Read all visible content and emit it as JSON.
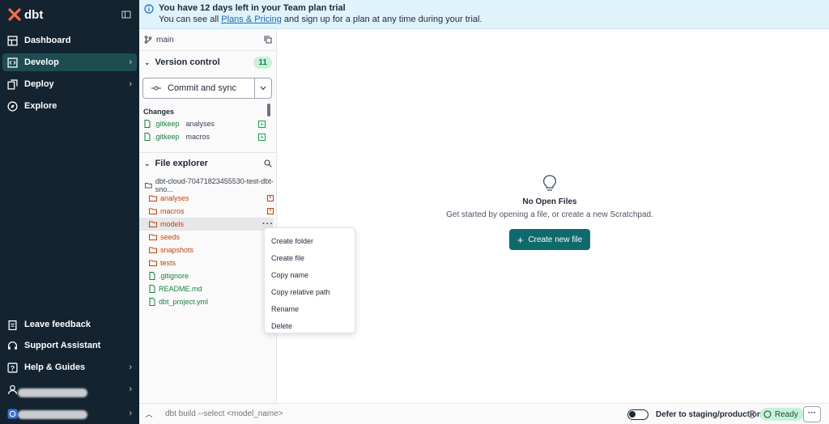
{
  "app": {
    "brand": "dbt"
  },
  "nav": {
    "items": [
      {
        "label": "Dashboard",
        "icon": "dashboard-icon"
      },
      {
        "label": "Develop",
        "icon": "code-icon",
        "active": true
      },
      {
        "label": "Deploy",
        "icon": "deploy-icon"
      },
      {
        "label": "Explore",
        "icon": "compass-icon"
      }
    ],
    "bottom_items": [
      {
        "label": "Leave feedback",
        "icon": "clipboard-icon"
      },
      {
        "label": "Support Assistant",
        "icon": "headset-icon"
      },
      {
        "label": "Help & Guides",
        "icon": "help-icon"
      }
    ]
  },
  "banner": {
    "title": "You have 12 days left in your Team plan trial",
    "text_before": "You can see all ",
    "link": "Plans & Pricing",
    "text_after": " and sign up for a plan at any time during your trial."
  },
  "panel": {
    "branch": "main",
    "version_control": {
      "title": "Version control",
      "count": "11",
      "commit_label": "Commit and sync",
      "changes_label": "Changes",
      "changes": [
        {
          "file": ".gitkeep",
          "dir": "analyses"
        },
        {
          "file": ".gitkeep",
          "dir": "macros"
        }
      ]
    },
    "file_explorer": {
      "title": "File explorer",
      "root": "dbt-cloud-70471823455530-test-dbt-sno...",
      "items": [
        {
          "name": "analyses",
          "kind": "folder"
        },
        {
          "name": "macros",
          "kind": "folder"
        },
        {
          "name": "models",
          "kind": "folder"
        },
        {
          "name": "seeds",
          "kind": "folder"
        },
        {
          "name": "snapshots",
          "kind": "folder"
        },
        {
          "name": "tests",
          "kind": "folder"
        },
        {
          "name": ".gitignore",
          "kind": "file"
        },
        {
          "name": "README.md",
          "kind": "file"
        },
        {
          "name": "dbt_project.yml",
          "kind": "file"
        }
      ]
    }
  },
  "context_menu": {
    "items": [
      "Create folder",
      "Create file",
      "Copy name",
      "Copy relative path",
      "Rename",
      "Delete"
    ]
  },
  "main": {
    "empty_title": "No Open Files",
    "empty_sub": "Get started by opening a file, or create a new Scratchpad.",
    "new_file_label": "Create new file"
  },
  "bottom": {
    "command_placeholder": "dbt build --select <model_name>",
    "defer_label": "Defer to staging/production",
    "status": "Ready",
    "more": "···"
  },
  "colors": {
    "nav_bg": "#13232f",
    "accent": "#0f6a6e",
    "banner_bg": "#dff3fb",
    "added_green": "#15803d",
    "folder_orange": "#c2410c"
  }
}
